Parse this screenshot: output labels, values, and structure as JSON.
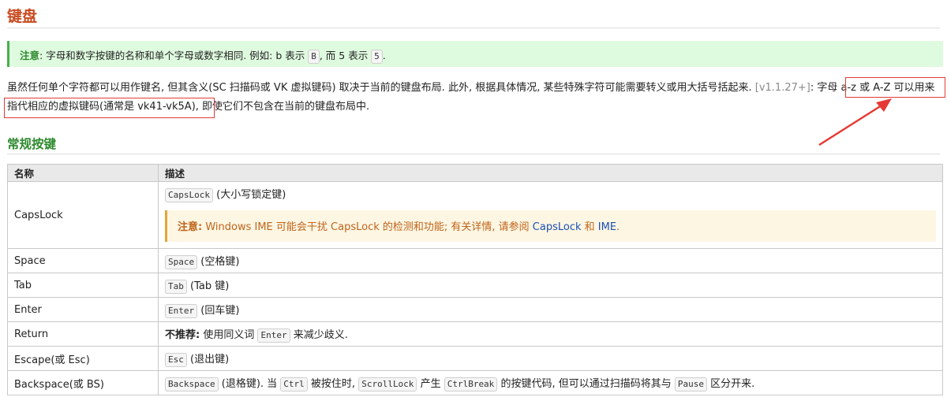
{
  "page": {
    "title": "键盘",
    "note": {
      "label": "注意",
      "text1": ": 字母和数字按键的名称和单个字母或数字相同. 例如: b 表示 ",
      "key1": "B",
      "text2": ", 而 5 表示 ",
      "key2": "5",
      "text3": "."
    },
    "paragraph": {
      "part1": "虽然任何单个字符都可以用作键名, 但其含义(SC 扫描码或 VK 虚拟键码) 取决于当前的键盘布局. 此外, 根据具体情况, 某些特殊字符可能需要转义或用大括号括起来. ",
      "version": "[v1.1.27+]",
      "part2": ": 字母 a-z 或 A-Z 可以用来指代相应的虚拟键码(通常是 vk41-vk5A), 即使它们不包含在当前的键盘布局中."
    },
    "section_title": "常规按键",
    "table": {
      "col_name": "名称",
      "col_desc": "描述",
      "capslock": {
        "name": "CapsLock",
        "key": "CapsLock",
        "desc": " (大小写锁定键)",
        "warn_label": "注意:",
        "warn_text": " Windows IME 可能会干扰 CapsLock 的检测和功能; 有关详情, 请参阅 ",
        "warn_link1": "CapsLock",
        "warn_and": " 和 ",
        "warn_link2": "IME",
        "warn_end": "."
      },
      "space": {
        "name": "Space",
        "key": "Space",
        "desc": " (空格键)"
      },
      "tab": {
        "name": "Tab",
        "key": "Tab",
        "desc": " (Tab 键)"
      },
      "enter": {
        "name": "Enter",
        "key": "Enter",
        "desc": " (回车键)"
      },
      "return": {
        "name": "Return",
        "label": "不推荐:",
        "text1": " 使用同义词 ",
        "key": "Enter",
        "text2": " 来减少歧义."
      },
      "escape": {
        "name": "Escape(或 Esc)",
        "key": "Esc",
        "desc": " (退出键)"
      },
      "backspace": {
        "name": "Backspace(或 BS)",
        "key": "Backspace",
        "text1": " (退格键). 当 ",
        "key_ctrl": "Ctrl",
        "text2": " 被按住时, ",
        "key_scroll": "ScrollLock",
        "text3": " 产生 ",
        "key_break": "CtrlBreak",
        "text4": " 的按键代码, 但可以通过扫描码将其与 ",
        "key_pause": "Pause",
        "text5": " 区分开来."
      }
    }
  }
}
